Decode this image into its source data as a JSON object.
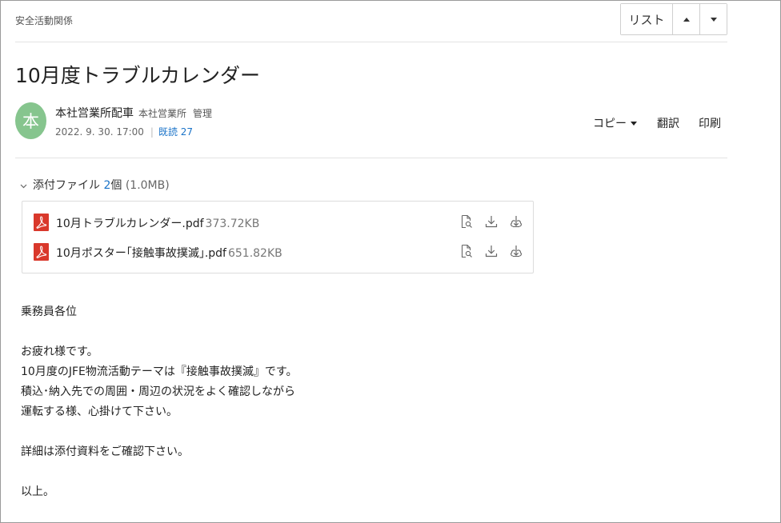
{
  "breadcrumb": "安全活動関係",
  "nav": {
    "list_label": "リスト"
  },
  "post": {
    "title": "10月度トラブルカレンダー",
    "avatar_char": "本",
    "sender": "本社営業所配車",
    "department": "本社営業所",
    "role": "管理",
    "date": "2022. 9. 30. 17:00",
    "read_label": "既読 27"
  },
  "actions": {
    "copy": "コピー",
    "translate": "翻訳",
    "print": "印刷"
  },
  "attachments": {
    "label": "添付ファイル",
    "count": "2",
    "count_suffix": "個",
    "total_size": "(1.0MB)",
    "files": [
      {
        "name": "10月トラブルカレンダー.pdf",
        "size": "373.72KB"
      },
      {
        "name": "10月ポスター｢接触事故撲滅｣.pdf",
        "size": "651.82KB"
      }
    ]
  },
  "body": {
    "lines": [
      "乗務員各位",
      "",
      "お疲れ様です。",
      "10月度のJFE物流活動テーマは『接触事故撲滅』です。",
      "積込･納入先での周囲・周辺の状況をよく確認しながら",
      "運転する様、心掛けて下さい。",
      "",
      "詳細は添付資料をご確認下さい。",
      "",
      "以上。"
    ]
  },
  "colors": {
    "avatar": "#86c58e",
    "link": "#1a73c8",
    "pdf": "#d9382b"
  },
  "icons": [
    "chevron-down-icon",
    "pdf-icon",
    "preview-icon",
    "download-icon",
    "cloud-download-icon",
    "caret-up-icon",
    "caret-down-icon"
  ]
}
